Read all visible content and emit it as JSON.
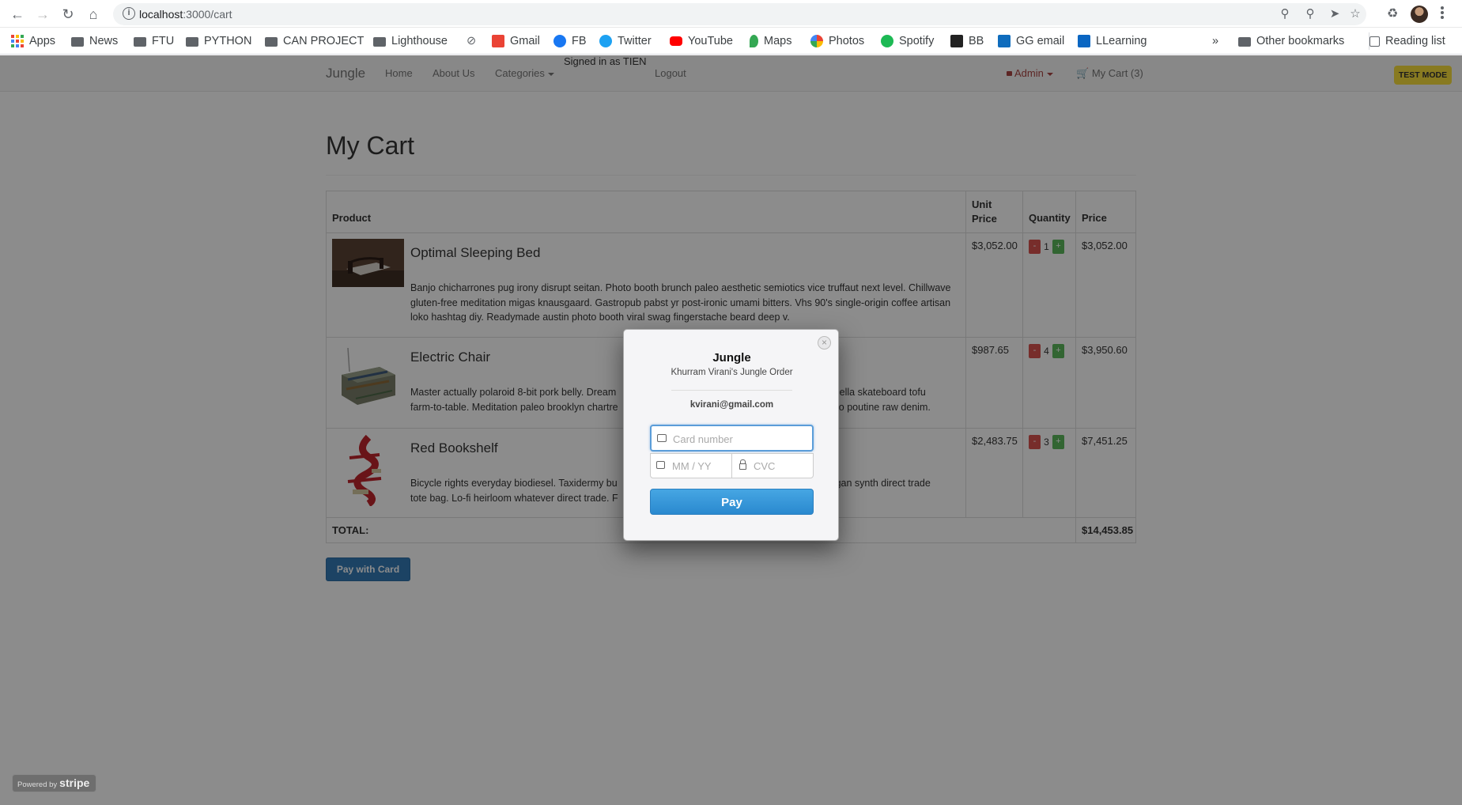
{
  "browser": {
    "url_host": "localhost",
    "url_rest": ":3000/cart",
    "bookmarks": [
      {
        "label": "Apps",
        "color": "#ea4335",
        "kind": "apps"
      },
      {
        "label": "News",
        "kind": "folder"
      },
      {
        "label": "FTU",
        "kind": "folder"
      },
      {
        "label": "PYTHON",
        "kind": "folder"
      },
      {
        "label": "CAN PROJECT",
        "kind": "folder"
      },
      {
        "label": "Lighthouse",
        "kind": "folder"
      },
      {
        "label": "",
        "kind": "link"
      },
      {
        "label": "Gmail",
        "color": "#ea4335",
        "kind": "site"
      },
      {
        "label": "FB",
        "color": "#1877f2",
        "kind": "site"
      },
      {
        "label": "Twitter",
        "color": "#1da1f2",
        "kind": "site"
      },
      {
        "label": "YouTube",
        "color": "#ff0000",
        "kind": "site"
      },
      {
        "label": "Maps",
        "color": "#34a853",
        "kind": "site"
      },
      {
        "label": "Photos",
        "color": "#fbbc04",
        "kind": "site"
      },
      {
        "label": "Spotify",
        "color": "#1db954",
        "kind": "site"
      },
      {
        "label": "BB",
        "color": "#222222",
        "kind": "site"
      },
      {
        "label": "GG email",
        "color": "#0f6cbd",
        "kind": "site"
      },
      {
        "label": "LLearning",
        "color": "#0a66c2",
        "kind": "site"
      }
    ],
    "more_label": "»",
    "other_bookmarks": "Other bookmarks",
    "reading_list": "Reading list"
  },
  "navbar": {
    "brand": "Jungle",
    "home": "Home",
    "about": "About Us",
    "categories": "Categories",
    "signed_in": "Signed in as TIEN",
    "logout": "Logout",
    "admin": "Admin",
    "cart": "My Cart (3)",
    "test_mode": "TEST MODE"
  },
  "page": {
    "title": "My Cart",
    "headers": {
      "product": "Product",
      "unit_price": "Unit Price",
      "quantity": "Quantity",
      "price": "Price"
    },
    "items": [
      {
        "name": "Optimal Sleeping Bed",
        "description": "Banjo chicharrones pug irony disrupt seitan. Photo booth brunch paleo aesthetic semiotics vice truffaut next level. Chillwave gluten-free meditation migas knausgaard. Gastropub pabst yr post-ironic umami bitters. Vhs 90's single-origin coffee artisan loko hashtag diy. Readymade austin photo booth viral swag fingerstache beard deep v.",
        "unit_price": "$3,052.00",
        "quantity": "1",
        "price": "$3,052.00"
      },
      {
        "name": "Electric Chair",
        "description": "Master actually polaroid 8-bit pork belly. Dream",
        "description_tail": "b hella skateboard tofu",
        "description2": "farm-to-table. Meditation paleo brooklyn chartre",
        "description2_tail": "echo poutine raw denim.",
        "unit_price": "$987.65",
        "quantity": "4",
        "price": "$3,950.60"
      },
      {
        "name": "Red Bookshelf",
        "description": "Bicycle rights everyday biodiesel. Taxidermy bu",
        "description_tail": "eegan synth direct trade",
        "description2": "tote bag. Lo-fi heirloom whatever direct trade. F",
        "unit_price": "$2,483.75",
        "quantity": "3",
        "price": "$7,451.25"
      }
    ],
    "total_label": "TOTAL:",
    "total_value": "$14,453.85",
    "pay_button": "Pay with Card"
  },
  "modal": {
    "title": "Jungle",
    "subtitle": "Khurram Virani's Jungle Order",
    "email": "kvirani@gmail.com",
    "card_placeholder": "Card number",
    "exp_placeholder": "MM / YY",
    "cvc_placeholder": "CVC",
    "pay_label": "Pay",
    "close": "×"
  },
  "powered_by": {
    "prefix": "Powered by",
    "brand": "stripe"
  }
}
